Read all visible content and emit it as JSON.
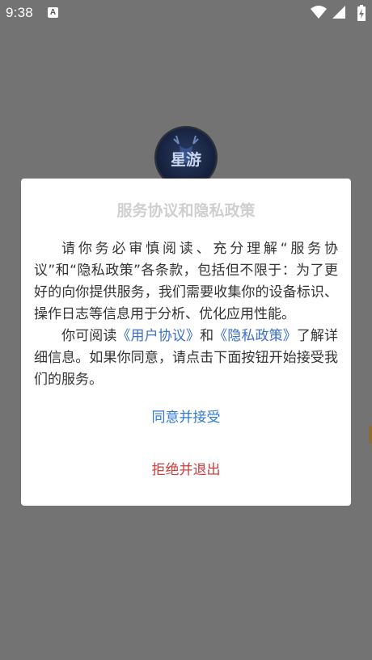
{
  "status_bar": {
    "time": "9:38",
    "notification_icon": "A",
    "icons": [
      "wifi-icon",
      "signal-icon",
      "battery-charging-icon"
    ]
  },
  "logo": {
    "text": "星游",
    "icon": "deer-head-logo"
  },
  "dialog": {
    "title": "服务协议和隐私政策",
    "paragraph1": "请你务必审慎阅读、充分理解“服务协议”和“隐私政策”各条款，包括但不限于：为了更好的向你提供服务，我们需要收集你的设备标识、操作日志等信息用于分析、优化应用性能。",
    "paragraph2_prefix": "你可阅读",
    "user_agreement_link": "《用户协议》",
    "paragraph2_and": "和",
    "privacy_policy_link": "《隐私政策》",
    "paragraph2_suffix": "了解详细信息。如果你同意，请点击下面按钮开始接受我们的服务。",
    "accept_label": "同意并接受",
    "reject_label": "拒绝并退出"
  },
  "colors": {
    "overlay": "#737373",
    "accept": "#2f7ad1",
    "reject": "#d13b3b",
    "link": "#3b6fc8"
  }
}
